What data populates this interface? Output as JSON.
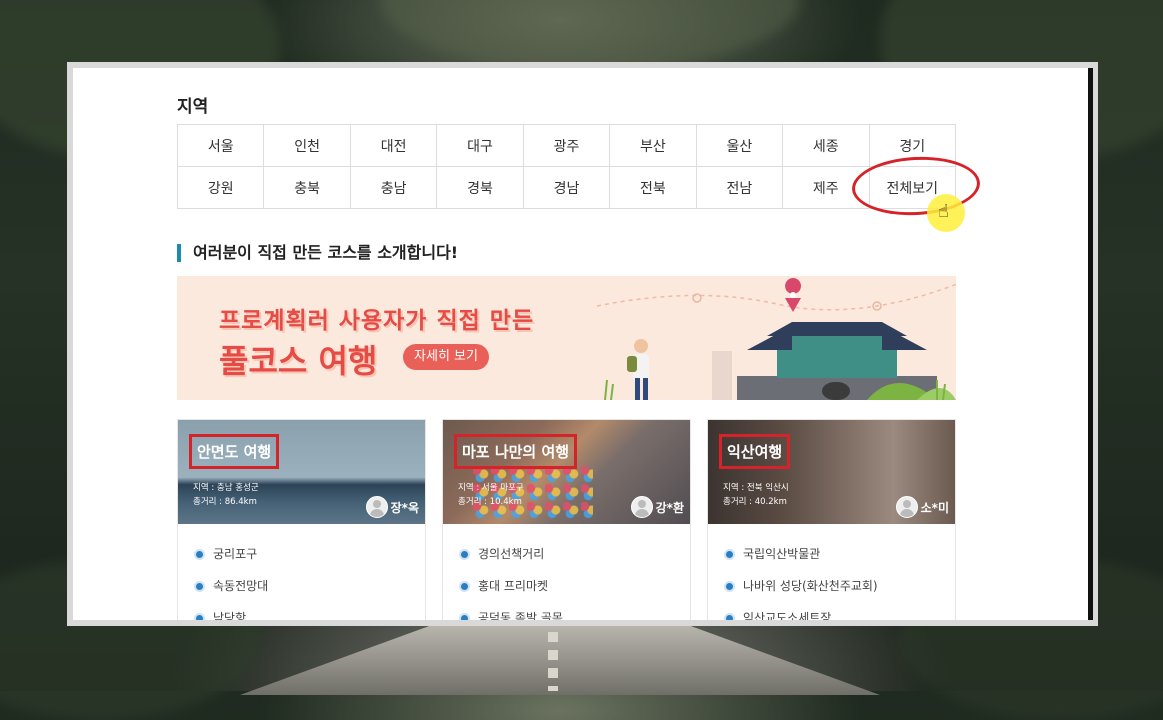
{
  "region_section": {
    "title": "지역",
    "rows": [
      [
        "서울",
        "인천",
        "대전",
        "대구",
        "광주",
        "부산",
        "울산",
        "세종",
        "경기"
      ],
      [
        "강원",
        "충북",
        "충남",
        "경북",
        "경남",
        "전북",
        "전남",
        "제주",
        "전체보기"
      ]
    ]
  },
  "courses_section": {
    "title": "여러분이 직접 만든 코스를 소개합니다!"
  },
  "banner": {
    "line1": "프로계획러 사용자가 직접 만든",
    "line2": "풀코스 여행",
    "button": "자세히 보기"
  },
  "cards": [
    {
      "name": "안면도 여행",
      "region": "지역 : 충남 홍성군",
      "distance": "총거리 : 86.4km",
      "user": "장*옥",
      "places": [
        "궁리포구",
        "속동전망대",
        "남당항"
      ]
    },
    {
      "name": "마포 나만의 여행",
      "region": "지역 : 서울 마포구",
      "distance": "총거리 : 10.4km",
      "user": "강*환",
      "places": [
        "경의선책거리",
        "홍대 프리마켓",
        "공덕동 족발 골목"
      ]
    },
    {
      "name": "익산여행",
      "region": "지역 : 전북 익산시",
      "distance": "총거리 : 40.2km",
      "user": "소*미",
      "places": [
        "국립익산박물관",
        "나바위 성당(화산천주교회)",
        "익산교도소세트장"
      ]
    }
  ],
  "colors": {
    "accent": "#1c8ab3",
    "highlight": "#d6232a",
    "banner_bg": "#fbe9de",
    "banner_text": "#e64b45"
  }
}
